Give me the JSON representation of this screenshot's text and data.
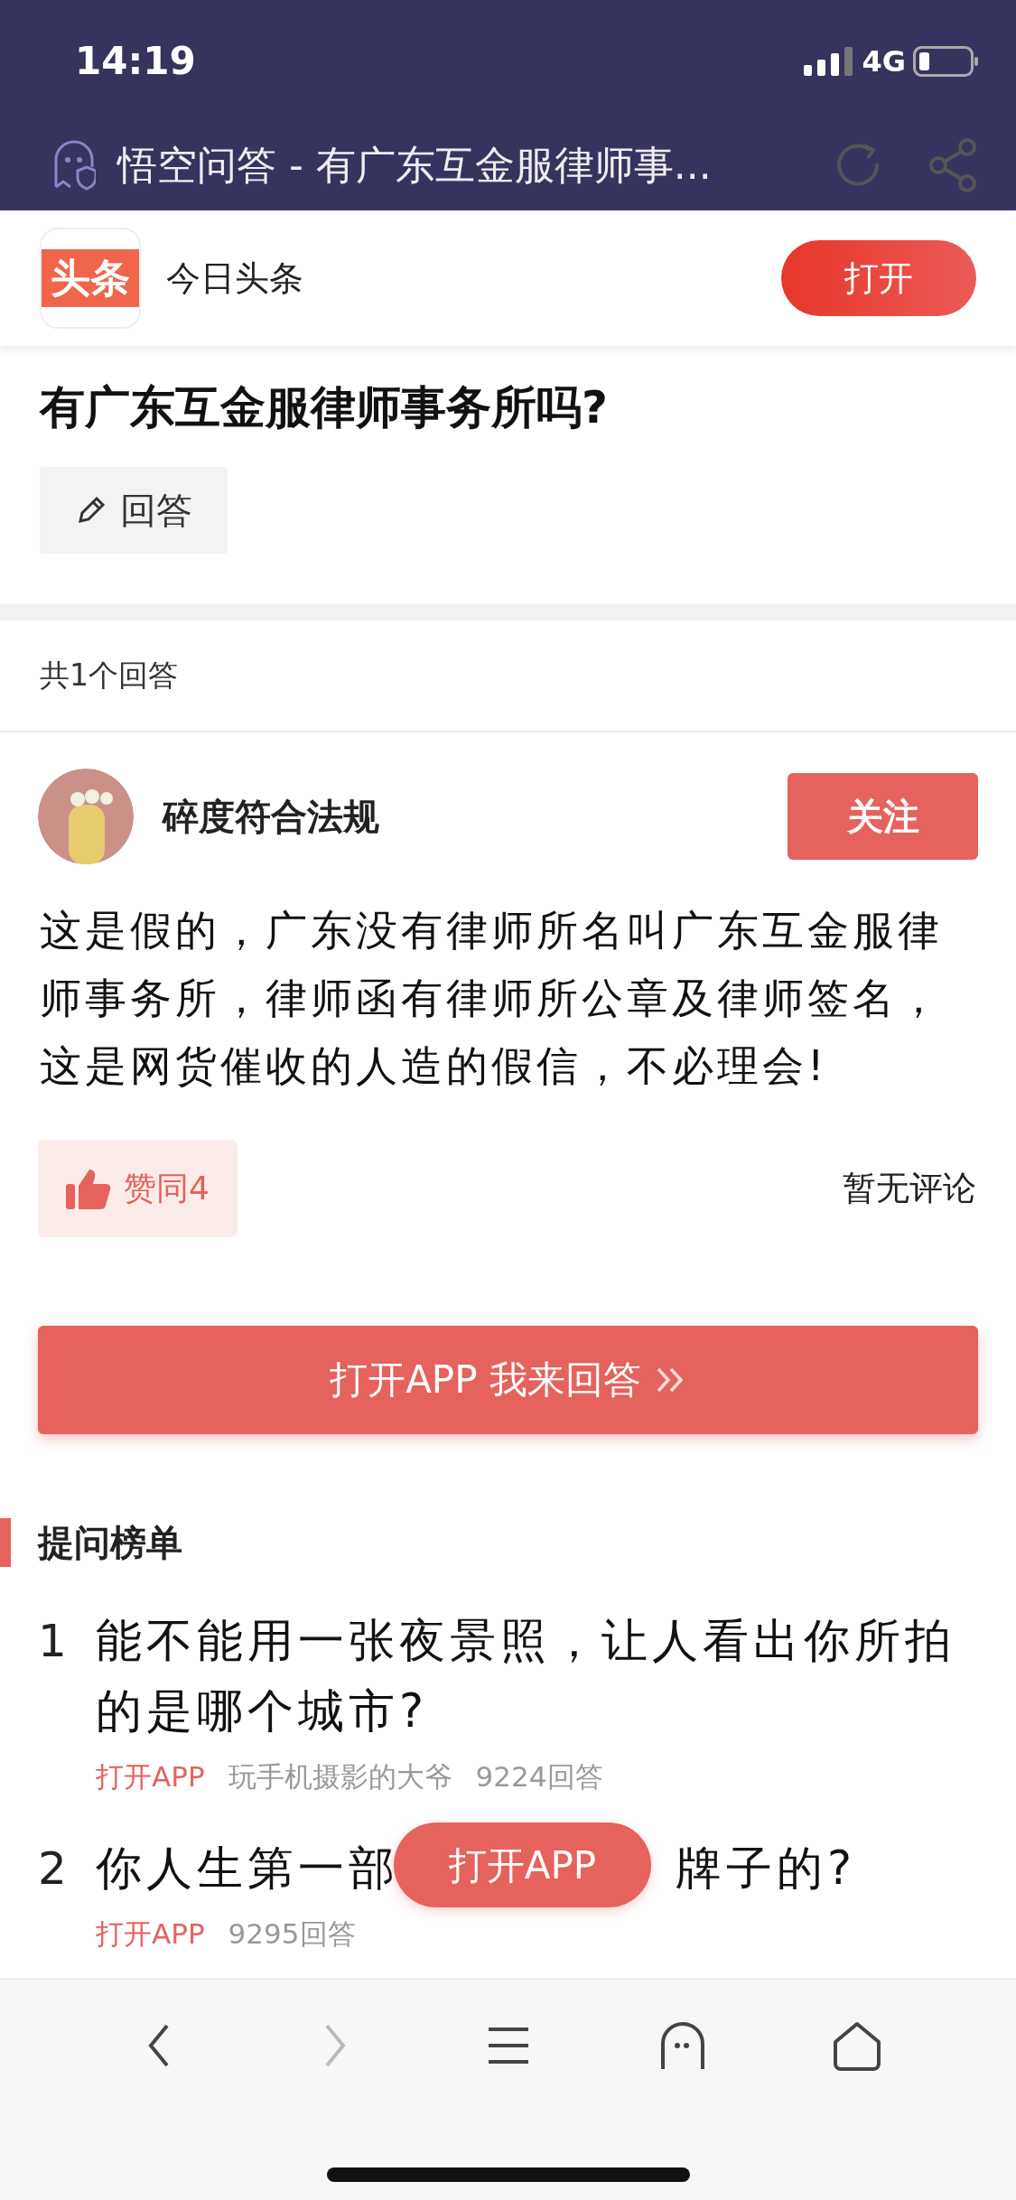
{
  "status_bar": {
    "time": "14:19",
    "network": "4G"
  },
  "browser": {
    "title": "悟空问答 - 有广东互金服律师事..."
  },
  "app_banner": {
    "logo_text": "头条",
    "name": "今日头条",
    "button": "打开"
  },
  "question": {
    "title": "有广东互金服律师事务所吗?",
    "answer_button": "回答"
  },
  "answers_count": "共1个回答",
  "answer": {
    "author": "碎度符合法规",
    "follow_button": "关注",
    "text": "这是假的，广东没有律师所名叫广东互金服律师事务所，律师函有律师所公章及律师签名，这是网货催收的人造的假信，不必理会!",
    "like_button": "赞同4",
    "comments": "暂无评论"
  },
  "open_app_answer_button": "打开APP 我来回答",
  "ranking": {
    "title": "提问榜单",
    "items": [
      {
        "number": "1",
        "title_parts": [
          "能不能用一张夜景照，让人看出你所拍的是哪个城市?"
        ],
        "open_app": "打开APP",
        "author": "玩手机摄影的大爷",
        "answers": "9224回答"
      },
      {
        "number": "2",
        "title_parts": [
          "你人生第一部",
          "牌子的?"
        ],
        "open_app": "打开APP",
        "answers": "9295回答"
      }
    ]
  },
  "floating_button": "打开APP"
}
